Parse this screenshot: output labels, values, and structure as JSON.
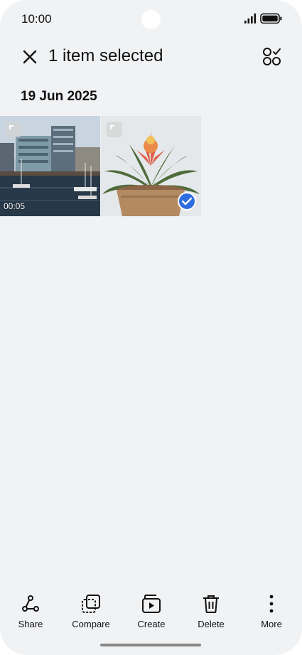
{
  "status_bar": {
    "time": "10:00",
    "icons": [
      "signal-icon",
      "battery-icon"
    ]
  },
  "header": {
    "title": "1 item selected",
    "close_icon": "close-icon",
    "select_all_icon": "select-all-icon"
  },
  "gallery": {
    "date": "19 Jun 2025",
    "items": [
      {
        "kind": "video",
        "duration": "00:05",
        "selected": false,
        "subject": "harbour-buildings"
      },
      {
        "kind": "photo",
        "selected": true,
        "subject": "potted-plant"
      }
    ]
  },
  "toolbar": {
    "actions": [
      {
        "label": "Share",
        "icon": "share-icon"
      },
      {
        "label": "Compare",
        "icon": "compare-icon"
      },
      {
        "label": "Create",
        "icon": "create-icon"
      },
      {
        "label": "Delete",
        "icon": "delete-icon"
      },
      {
        "label": "More",
        "icon": "more-icon"
      }
    ]
  },
  "colors": {
    "background": "#f1f2f4",
    "accent": "#2f6ee0",
    "text": "#111111"
  }
}
